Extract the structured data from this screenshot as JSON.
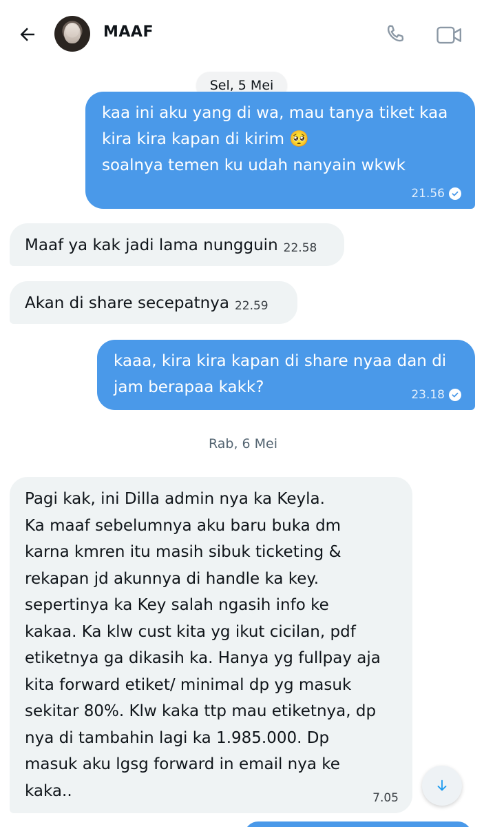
{
  "header": {
    "title": "MAAF",
    "back_icon": "arrow-left-icon",
    "call_icon": "phone-icon",
    "video_icon": "video-camera-icon"
  },
  "dates": {
    "first": "Sel, 5 Mei",
    "second": "Rab, 6 Mei"
  },
  "messages": [
    {
      "direction": "outgoing",
      "text": "kaa ini aku yang di wa, mau tanya tiket kaa\nkira kira kapan di kirim 🥺\nsoalnya temen ku udah nanyain wkwk",
      "time": "21.56",
      "status_icon": "read-check-icon"
    },
    {
      "direction": "incoming",
      "text": "Maaf ya kak jadi lama nungguin",
      "time": "22.58"
    },
    {
      "direction": "incoming",
      "text": "Akan di share secepatnya",
      "time": "22.59"
    },
    {
      "direction": "outgoing",
      "text": "kaaa, kira kira kapan di share nyaa dan di\njam berapaa kakk?",
      "time": "23.18",
      "status_icon": "read-check-icon"
    },
    {
      "direction": "incoming",
      "text": "Pagi kak, ini Dilla admin nya ka Keyla.\nKa maaf sebelumnya aku baru buka dm\nkarna kmren itu masih sibuk ticketing &\nrekapan jd akunnya di handle ka key.\nsepertinya ka Key salah ngasih info ke\nkakaa. Ka klw cust kita yg ikut cicilan, pdf\netiketnya ga dikasih ka. Hanya yg fullpay aja\nkita forward etiket/ minimal dp yg masuk\nsekitar 80%. Klw kaka ttp mau etiketnya, dp\nnya di tambahin lagi ka 1.985.000. Dp\nmasuk aku lgsg forward in email nya ke\nkaka..",
      "time": "7.05"
    }
  ],
  "scroll_button": {
    "icon": "arrow-down-icon"
  },
  "colors": {
    "outgoing_bubble": "#4a99e9",
    "incoming_bubble": "#eff3f4",
    "accent": "#1d9bf0"
  }
}
